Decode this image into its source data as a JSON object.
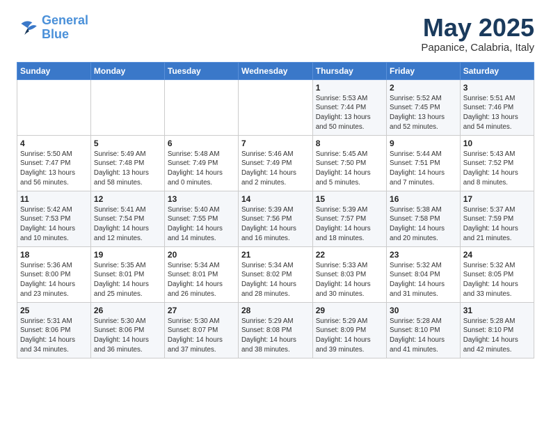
{
  "logo": {
    "line1": "General",
    "line2": "Blue"
  },
  "title": "May 2025",
  "subtitle": "Papanice, Calabria, Italy",
  "headers": [
    "Sunday",
    "Monday",
    "Tuesday",
    "Wednesday",
    "Thursday",
    "Friday",
    "Saturday"
  ],
  "weeks": [
    [
      {
        "day": "",
        "info": ""
      },
      {
        "day": "",
        "info": ""
      },
      {
        "day": "",
        "info": ""
      },
      {
        "day": "",
        "info": ""
      },
      {
        "day": "1",
        "info": "Sunrise: 5:53 AM\nSunset: 7:44 PM\nDaylight: 13 hours\nand 50 minutes."
      },
      {
        "day": "2",
        "info": "Sunrise: 5:52 AM\nSunset: 7:45 PM\nDaylight: 13 hours\nand 52 minutes."
      },
      {
        "day": "3",
        "info": "Sunrise: 5:51 AM\nSunset: 7:46 PM\nDaylight: 13 hours\nand 54 minutes."
      }
    ],
    [
      {
        "day": "4",
        "info": "Sunrise: 5:50 AM\nSunset: 7:47 PM\nDaylight: 13 hours\nand 56 minutes."
      },
      {
        "day": "5",
        "info": "Sunrise: 5:49 AM\nSunset: 7:48 PM\nDaylight: 13 hours\nand 58 minutes."
      },
      {
        "day": "6",
        "info": "Sunrise: 5:48 AM\nSunset: 7:49 PM\nDaylight: 14 hours\nand 0 minutes."
      },
      {
        "day": "7",
        "info": "Sunrise: 5:46 AM\nSunset: 7:49 PM\nDaylight: 14 hours\nand 2 minutes."
      },
      {
        "day": "8",
        "info": "Sunrise: 5:45 AM\nSunset: 7:50 PM\nDaylight: 14 hours\nand 5 minutes."
      },
      {
        "day": "9",
        "info": "Sunrise: 5:44 AM\nSunset: 7:51 PM\nDaylight: 14 hours\nand 7 minutes."
      },
      {
        "day": "10",
        "info": "Sunrise: 5:43 AM\nSunset: 7:52 PM\nDaylight: 14 hours\nand 8 minutes."
      }
    ],
    [
      {
        "day": "11",
        "info": "Sunrise: 5:42 AM\nSunset: 7:53 PM\nDaylight: 14 hours\nand 10 minutes."
      },
      {
        "day": "12",
        "info": "Sunrise: 5:41 AM\nSunset: 7:54 PM\nDaylight: 14 hours\nand 12 minutes."
      },
      {
        "day": "13",
        "info": "Sunrise: 5:40 AM\nSunset: 7:55 PM\nDaylight: 14 hours\nand 14 minutes."
      },
      {
        "day": "14",
        "info": "Sunrise: 5:39 AM\nSunset: 7:56 PM\nDaylight: 14 hours\nand 16 minutes."
      },
      {
        "day": "15",
        "info": "Sunrise: 5:39 AM\nSunset: 7:57 PM\nDaylight: 14 hours\nand 18 minutes."
      },
      {
        "day": "16",
        "info": "Sunrise: 5:38 AM\nSunset: 7:58 PM\nDaylight: 14 hours\nand 20 minutes."
      },
      {
        "day": "17",
        "info": "Sunrise: 5:37 AM\nSunset: 7:59 PM\nDaylight: 14 hours\nand 21 minutes."
      }
    ],
    [
      {
        "day": "18",
        "info": "Sunrise: 5:36 AM\nSunset: 8:00 PM\nDaylight: 14 hours\nand 23 minutes."
      },
      {
        "day": "19",
        "info": "Sunrise: 5:35 AM\nSunset: 8:01 PM\nDaylight: 14 hours\nand 25 minutes."
      },
      {
        "day": "20",
        "info": "Sunrise: 5:34 AM\nSunset: 8:01 PM\nDaylight: 14 hours\nand 26 minutes."
      },
      {
        "day": "21",
        "info": "Sunrise: 5:34 AM\nSunset: 8:02 PM\nDaylight: 14 hours\nand 28 minutes."
      },
      {
        "day": "22",
        "info": "Sunrise: 5:33 AM\nSunset: 8:03 PM\nDaylight: 14 hours\nand 30 minutes."
      },
      {
        "day": "23",
        "info": "Sunrise: 5:32 AM\nSunset: 8:04 PM\nDaylight: 14 hours\nand 31 minutes."
      },
      {
        "day": "24",
        "info": "Sunrise: 5:32 AM\nSunset: 8:05 PM\nDaylight: 14 hours\nand 33 minutes."
      }
    ],
    [
      {
        "day": "25",
        "info": "Sunrise: 5:31 AM\nSunset: 8:06 PM\nDaylight: 14 hours\nand 34 minutes."
      },
      {
        "day": "26",
        "info": "Sunrise: 5:30 AM\nSunset: 8:06 PM\nDaylight: 14 hours\nand 36 minutes."
      },
      {
        "day": "27",
        "info": "Sunrise: 5:30 AM\nSunset: 8:07 PM\nDaylight: 14 hours\nand 37 minutes."
      },
      {
        "day": "28",
        "info": "Sunrise: 5:29 AM\nSunset: 8:08 PM\nDaylight: 14 hours\nand 38 minutes."
      },
      {
        "day": "29",
        "info": "Sunrise: 5:29 AM\nSunset: 8:09 PM\nDaylight: 14 hours\nand 39 minutes."
      },
      {
        "day": "30",
        "info": "Sunrise: 5:28 AM\nSunset: 8:10 PM\nDaylight: 14 hours\nand 41 minutes."
      },
      {
        "day": "31",
        "info": "Sunrise: 5:28 AM\nSunset: 8:10 PM\nDaylight: 14 hours\nand 42 minutes."
      }
    ]
  ]
}
